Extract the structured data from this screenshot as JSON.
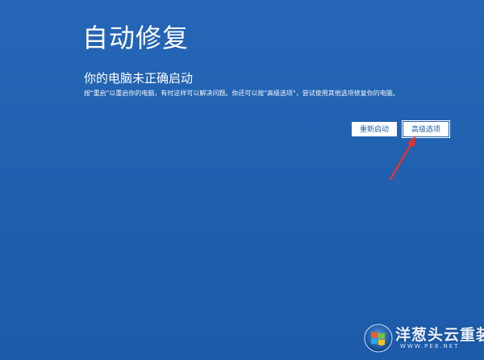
{
  "screen": {
    "title": "自动修复",
    "subtitle": "你的电脑未正确启动",
    "message": "按\"重启\"以重启你的电脑，有时这样可以解决问题。你还可以按\"高级选项\"，尝试使用其他选项修复你的电脑。"
  },
  "buttons": {
    "restart_label": "重新启动",
    "advanced_label": "高级选项"
  },
  "annotation": {
    "arrow_color": "#e8322b",
    "points_to": "advanced-options-button"
  },
  "watermark": {
    "name": "洋葱头云重装",
    "url": "WWW.PE8.NET",
    "icon": "windows-logo-icon"
  },
  "colors": {
    "background": "#2061b0",
    "text": "#ffffff",
    "button_text": "#1f5fae"
  }
}
